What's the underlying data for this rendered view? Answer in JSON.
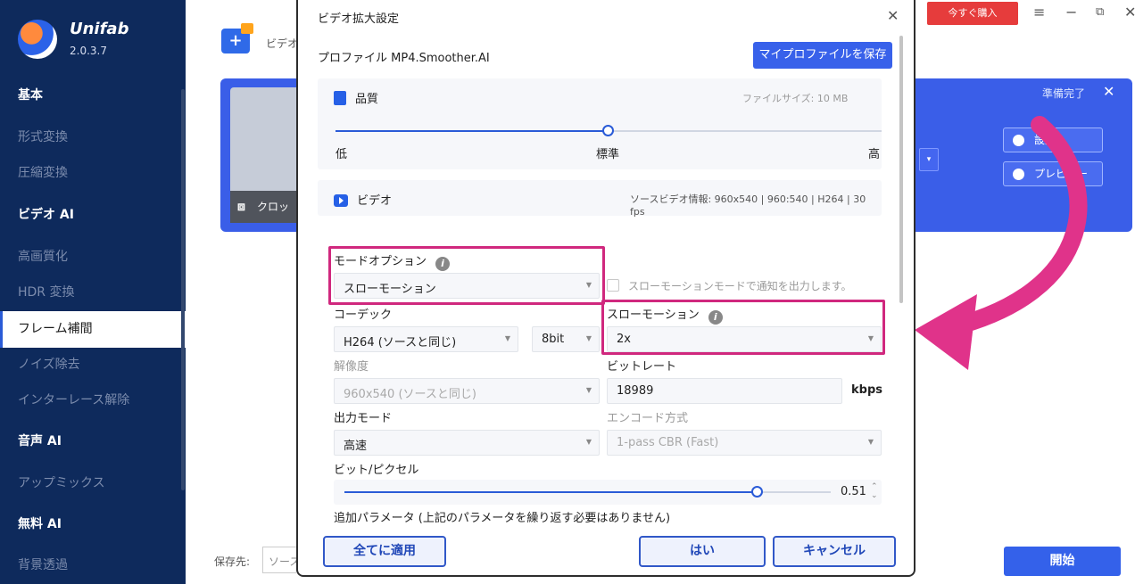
{
  "app": {
    "name": "Unifab",
    "version": "2.0.3.7"
  },
  "sidebar": {
    "items": [
      {
        "label": "基本",
        "type": "head"
      },
      {
        "label": "形式変換",
        "type": "item"
      },
      {
        "label": "圧縮変換",
        "type": "item"
      },
      {
        "label": "ビデオ AI",
        "type": "head"
      },
      {
        "label": "高画質化",
        "type": "item"
      },
      {
        "label": "HDR 変換",
        "type": "item"
      },
      {
        "label": "フレーム補間",
        "type": "active"
      },
      {
        "label": "ノイズ除去",
        "type": "item"
      },
      {
        "label": "インターレース解除",
        "type": "item"
      },
      {
        "label": "音声 AI",
        "type": "head"
      },
      {
        "label": "アップミックス",
        "type": "item"
      },
      {
        "label": "無料 AI",
        "type": "head"
      },
      {
        "label": "背景透過",
        "type": "item"
      }
    ]
  },
  "topbar": {
    "buy_label": "今すぐ購入",
    "menu_glyph": "≡",
    "min_glyph": "−",
    "max_glyph": "⧉",
    "close_glyph": "✕"
  },
  "background": {
    "add_video_label": "ビデオ",
    "crop_label": "クロッ",
    "ready_label": "準備完了",
    "settings_label": "設定",
    "preview_label": "プレビュー",
    "save_to_label": "保存先:",
    "save_to_value": "ソース",
    "start_label": "開始"
  },
  "dialog": {
    "title": "ビデオ拡大設定",
    "profile_label": "プロファイル  MP4.Smoother.AI",
    "save_profile_label": "マイプロファイルを保存",
    "quality": {
      "title": "品質",
      "file_size": "ファイルサイズ:  10 MB",
      "low": "低",
      "standard": "標準",
      "high": "高",
      "level": 0.5
    },
    "video": {
      "title": "ビデオ",
      "source_info": "ソースビデオ情報: 960x540 | 960:540 | H264 | 30 fps",
      "mode_option_label": "モードオプション",
      "mode_option_value": "スローモーション",
      "notify_label": "スローモーションモードで通知を出力します。",
      "codec_label": "コーデック",
      "codec_value": "H264 (ソースと同じ)",
      "bitdepth_value": "8bit",
      "slowmo_label": "スローモーション",
      "slowmo_value": "2x",
      "resolution_label": "解像度",
      "resolution_value": "960x540 (ソースと同じ)",
      "bitrate_label": "ビットレート",
      "bitrate_value": "18989",
      "bitrate_unit": "kbps",
      "output_mode_label": "出力モード",
      "output_mode_value": "高速",
      "encode_label": "エンコード方式",
      "encode_value": "1-pass CBR (Fast)",
      "bpp_label": "ビット/ピクセル",
      "bpp_value": "0.51",
      "bpp_level": 0.85,
      "extra_params": "追加パラメータ (上記のパラメータを繰り返す必要はありません)"
    },
    "buttons": {
      "apply_all": "全てに適用",
      "yes": "はい",
      "cancel": "キャンセル"
    }
  },
  "colors": {
    "sidebar": "#0e2a5c",
    "accent": "#3461ea",
    "highlight": "#d0287e",
    "buy": "#e63c3c"
  }
}
